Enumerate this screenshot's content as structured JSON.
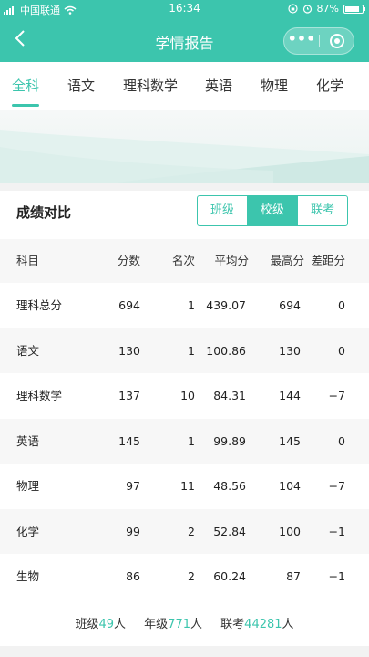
{
  "status_bar": {
    "carrier": "中国联通",
    "time": "16:34",
    "battery": "87%",
    "battery_level": 0.87
  },
  "nav": {
    "title": "学情报告",
    "more_label": "•••"
  },
  "tabs": [
    {
      "label": "全科",
      "active": true
    },
    {
      "label": "语文"
    },
    {
      "label": "理科数学"
    },
    {
      "label": "英语"
    },
    {
      "label": "物理"
    },
    {
      "label": "化学"
    }
  ],
  "comparison": {
    "title": "成绩对比",
    "segments": [
      {
        "label": "班级"
      },
      {
        "label": "校级",
        "active": true
      },
      {
        "label": "联考"
      }
    ]
  },
  "table": {
    "headers": [
      "科目",
      "分数",
      "名次",
      "平均分",
      "最高分",
      "差距分"
    ],
    "rows": [
      [
        "理科总分",
        "694",
        "1",
        "439.07",
        "694",
        "0"
      ],
      [
        "语文",
        "130",
        "1",
        "100.86",
        "130",
        "0"
      ],
      [
        "理科数学",
        "137",
        "10",
        "84.31",
        "144",
        "−7"
      ],
      [
        "英语",
        "145",
        "1",
        "99.89",
        "145",
        "0"
      ],
      [
        "物理",
        "97",
        "11",
        "48.56",
        "104",
        "−7"
      ],
      [
        "化学",
        "99",
        "2",
        "52.84",
        "100",
        "−1"
      ],
      [
        "生物",
        "86",
        "2",
        "60.24",
        "87",
        "−1"
      ]
    ]
  },
  "footer": {
    "class_label": "班级",
    "class_count": "49",
    "class_unit": "人",
    "grade_label": "年级",
    "grade_count": "771",
    "grade_unit": "人",
    "joint_label": "联考",
    "joint_count": "44281",
    "joint_unit": "人"
  },
  "colors": {
    "accent": "#3cc5ad"
  }
}
